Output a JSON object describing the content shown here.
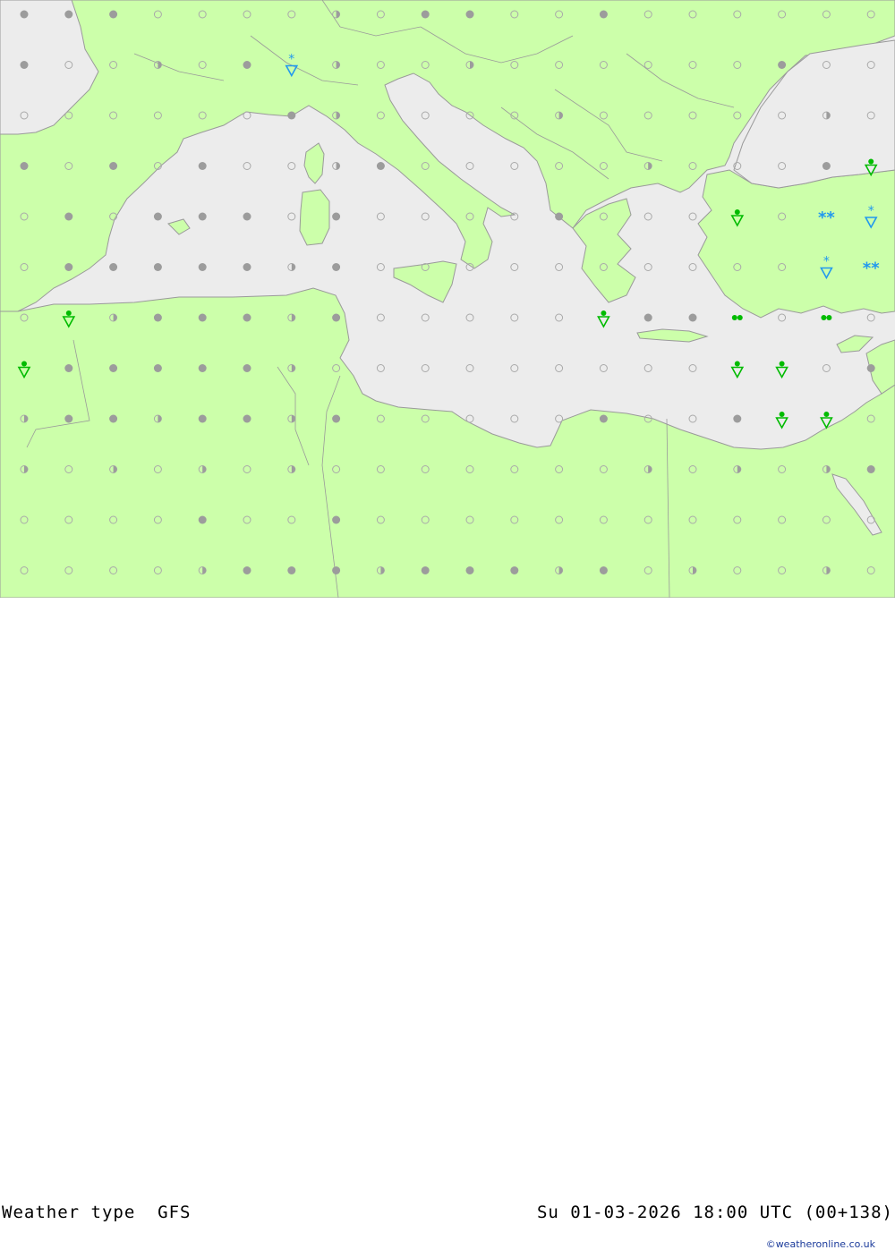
{
  "map": {
    "colors": {
      "land": "#ccffaa",
      "sea": "#ececec",
      "border": "#9a9a9a",
      "cloud_open": "#a9a9a9",
      "cloud_filled": "#9c9c9c",
      "rain": "#00bb00",
      "snow": "#2299ee"
    },
    "symbols": {
      "open": "clear-sky-circle-icon",
      "half": "partly-cloudy-circle-icon",
      "filled": "overcast-circle-icon",
      "rain_shower": "rain-shower-icon",
      "snow_shower": "snow-shower-icon",
      "drizzle": "light-rain-dots-icon",
      "snow": "snow-asterisks-icon"
    }
  },
  "footer": {
    "title": "Weather type  GFS",
    "datetime": "Su 01-03-2026 18:00 UTC (00+138)",
    "credit": "©weatheronline.co.uk"
  }
}
